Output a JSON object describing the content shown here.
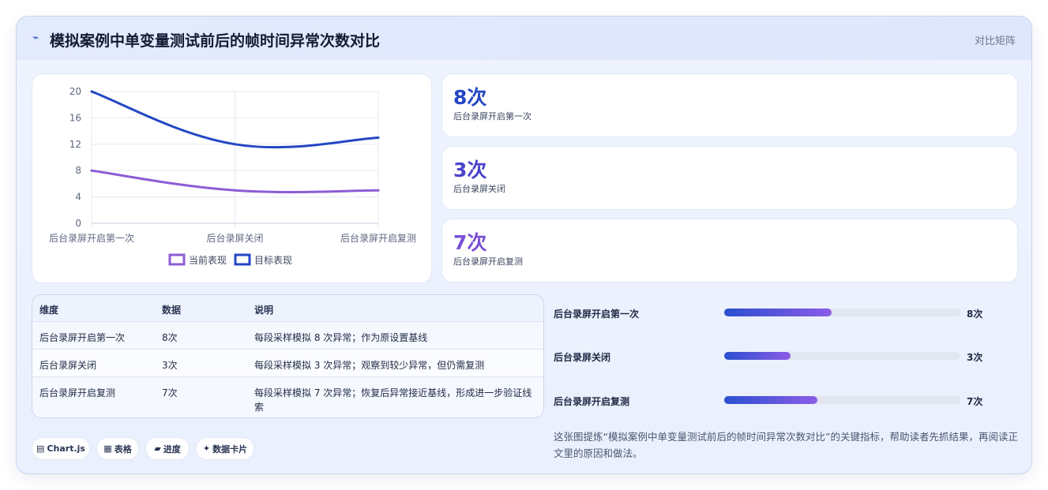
{
  "header": {
    "icon": "line-chart-icon",
    "title": "模拟案例中单变量测试前后的帧时间异常次数对比",
    "tag": "对比矩阵"
  },
  "chart_data": {
    "type": "line",
    "categories": [
      "后台录屏开启第一次",
      "后台录屏关闭",
      "后台录屏开启复测"
    ],
    "series": [
      {
        "name": "当前表现",
        "values": [
          8,
          5,
          5
        ],
        "color": "#8b5cd6"
      },
      {
        "name": "目标表现",
        "values": [
          20,
          12,
          13
        ],
        "color": "#2447c4"
      }
    ],
    "ylim": [
      0,
      20
    ],
    "yticks": [
      "0",
      "4",
      "8",
      "12",
      "16",
      "20"
    ],
    "grid": true,
    "legend": "bottom"
  },
  "stats": [
    {
      "value": "8次",
      "label": "后台录屏开启第一次",
      "color": "#2447c4"
    },
    {
      "value": "3次",
      "label": "后台录屏关闭",
      "color": "#4a43cc"
    },
    {
      "value": "7次",
      "label": "后台录屏开启复测",
      "color": "#7a4fd8"
    }
  ],
  "table": {
    "headers": [
      "维度",
      "数据",
      "说明"
    ],
    "rows": [
      [
        "后台录屏开启第一次",
        "8次",
        "每段采样模拟 8 次异常；作为原设置基线"
      ],
      [
        "后台录屏关闭",
        "3次",
        "每段采样模拟 3 次异常；观察到较少异常，但仍需复测"
      ],
      [
        "后台录屏开启复测",
        "7次",
        "每段采样模拟 7 次异常；恢复后异常接近基线，形成进一步验证线",
        "索"
      ]
    ]
  },
  "pills": [
    {
      "icon": "chart-icon",
      "glyph": "▤",
      "label": "Chart.js"
    },
    {
      "icon": "table-icon",
      "glyph": "▦",
      "label": "表格"
    },
    {
      "icon": "progress-icon",
      "glyph": "▰",
      "label": "进度"
    },
    {
      "icon": "sparkle-icon",
      "glyph": "✦",
      "label": "数据卡片"
    }
  ],
  "progress": [
    {
      "label": "后台录屏开启第一次",
      "value": "8次",
      "fraction": 0.455
    },
    {
      "label": "后台录屏关闭",
      "value": "3次",
      "fraction": 0.28
    },
    {
      "label": "后台录屏开启复测",
      "value": "7次",
      "fraction": 0.395
    }
  ],
  "note": "这张图提炼“模拟案例中单变量测试前后的帧时间异常次数对比”的关键指标，帮助读者先抓结果，再阅读正文里的原因和做法。"
}
